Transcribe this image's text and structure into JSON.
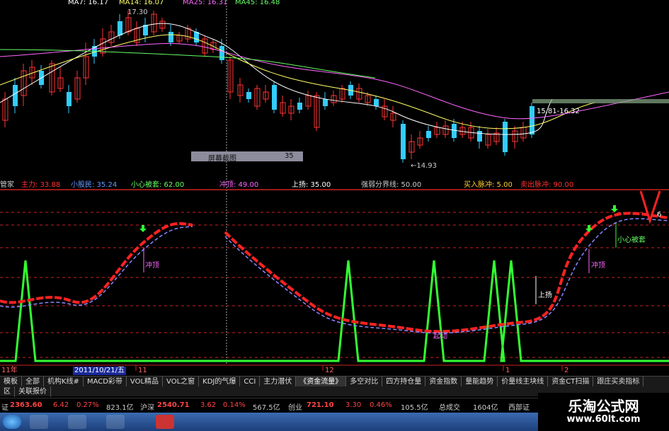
{
  "top_legend": [
    {
      "text": "MA7: 16.17",
      "color": "#ffffff"
    },
    {
      "text": "MA14: 16.07",
      "color": "#ffff66"
    },
    {
      "text": "MA25: 16.31",
      "color": "#ff66ff"
    },
    {
      "text": "MA45: 16.48",
      "color": "#66ff66"
    },
    {
      "text": "17.30",
      "color": "#cccccc"
    }
  ],
  "price_annotations": {
    "high": "17.30",
    "low": "←14.93",
    "range_label": "15.81-16.32"
  },
  "screen_box": {
    "label": "屏幕截图",
    "value": "35"
  },
  "indicator_row": [
    {
      "text": "管家",
      "color": "#cccccc"
    },
    {
      "text": "主力: 33.88",
      "color": "#ff3333"
    },
    {
      "text": "小股民: 35.24",
      "color": "#6699ff"
    },
    {
      "text": "小心被套: 62.00",
      "color": "#66ff66"
    },
    {
      "text": "冲顶: 49.00",
      "color": "#ff66ff"
    },
    {
      "text": "上扬: 35.00",
      "color": "#ffffff"
    },
    {
      "text": "强弱分界线: 50.00",
      "color": "#cccccc"
    },
    {
      "text": "买入脉冲: 5.00",
      "color": "#ffcc33"
    },
    {
      "text": "卖出脉冲: 90.00",
      "color": "#ff3333"
    }
  ],
  "chart_labels": {
    "chong_ding_1": "冲顶",
    "chong_ding_2": "冲顶",
    "shang_yang": "上扬",
    "xiao_xin": "小心被套",
    "qi_dong": "起动",
    "top_right": "6",
    "date_box": "2011/10/21/五",
    "axis_11": "11年",
    "axis_1a": "11",
    "axis_12": "12",
    "axis_1b": "1",
    "axis_2": "2"
  },
  "tabs": [
    "模板",
    "全部",
    "机构K线#",
    "MACD彩带",
    "VOL精品",
    "VOL之窗",
    "KDJ的气爆",
    "CCI",
    "主力潜伏",
    "《资金流量》",
    "多空对比",
    "四方持仓量",
    "资金指数",
    "量能趋势",
    "价量线主块线",
    "资金CT扫描",
    "跟庄买卖指标"
  ],
  "tabs2": [
    "区",
    "关联报价"
  ],
  "ticker": [
    {
      "text": "证",
      "color": "#cccccc"
    },
    {
      "text": "2363.60",
      "color": "#ff4444"
    },
    {
      "text": "6.42",
      "color": "#ff4444"
    },
    {
      "text": "0.27%",
      "color": "#ff4444"
    },
    {
      "text": "823.1亿",
      "color": "#cccccc"
    },
    {
      "text": "沪深",
      "color": "#cccccc"
    },
    {
      "text": "2540.71",
      "color": "#ff4444"
    },
    {
      "text": "3.62",
      "color": "#ff4444"
    },
    {
      "text": "0.14%",
      "color": "#ff4444"
    },
    {
      "text": "567.5亿",
      "color": "#cccccc"
    },
    {
      "text": "创业",
      "color": "#cccccc"
    },
    {
      "text": "721.10",
      "color": "#ff4444"
    },
    {
      "text": "3.30",
      "color": "#ff4444"
    },
    {
      "text": "0.46%",
      "color": "#ff4444"
    },
    {
      "text": "105.5亿",
      "color": "#cccccc"
    },
    {
      "text": "总成交",
      "color": "#cccccc"
    },
    {
      "text": "1604亿",
      "color": "#cccccc"
    },
    {
      "text": "西部证",
      "color": "#cccccc"
    }
  ],
  "watermark": {
    "line1": "乐淘公式网",
    "line2": "www.60lt.com"
  },
  "colors": {
    "up": "#ff3333",
    "down": "#33ccff",
    "zhuli": "#ff2222",
    "xiaogumin": "#8888ff",
    "pulse": "#33ff33",
    "grid": "#cc2222"
  }
}
